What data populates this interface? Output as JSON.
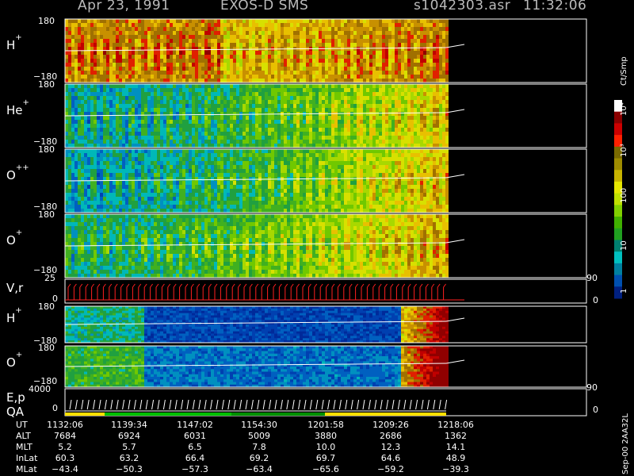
{
  "header": {
    "date": "Apr 23, 1991",
    "instrument": "EXOS-D SMS",
    "file": "s1042303.asr",
    "time": "11:32:06"
  },
  "panels": [
    {
      "ion": "H",
      "charge": "+",
      "y_top": "180",
      "y_bottom": "−180"
    },
    {
      "ion": "He",
      "charge": "+",
      "y_top": "180",
      "y_bottom": "−180"
    },
    {
      "ion": "O",
      "charge": "++",
      "y_top": "180",
      "y_bottom": "−180"
    },
    {
      "ion": "O",
      "charge": "+",
      "y_top": "180",
      "y_bottom": "−180"
    },
    {
      "ion": "V,r",
      "charge": "",
      "y_top": "25",
      "y_bottom": "0",
      "right_top": "90",
      "right_bottom": "0"
    },
    {
      "ion": "H",
      "charge": "+",
      "y_top": "180",
      "y_bottom": "−180"
    },
    {
      "ion": "O",
      "charge": "+",
      "y_top": "180",
      "y_bottom": "−180"
    },
    {
      "ion": "E,p",
      "charge": "",
      "y_top": "4000",
      "y_bottom": "0",
      "right_top": "90",
      "right_bottom": "0",
      "sub_label": "QA"
    }
  ],
  "colorbar": {
    "unit": "Ct/Smp",
    "tick_labels": [
      "10⁴",
      "10³",
      "100",
      "10",
      "1"
    ],
    "colors": [
      "#ffffff",
      "#8b0000",
      "#cc0000",
      "#ff2000",
      "#7a6a00",
      "#9e8c00",
      "#c8b400",
      "#e6e600",
      "#bfe000",
      "#80d000",
      "#40b000",
      "#20a020",
      "#008070",
      "#00c0c0",
      "#0080a0",
      "#0050b0",
      "#002080"
    ]
  },
  "footer": {
    "row_labels": [
      "UT",
      "ALT",
      "MLT",
      "InLat",
      "MLat"
    ],
    "columns": [
      [
        "1132:06",
        "7684",
        "5.2",
        "60.3",
        "−43.4"
      ],
      [
        "1139:34",
        "6924",
        "5.7",
        "63.2",
        "−50.3"
      ],
      [
        "1147:02",
        "6031",
        "6.5",
        "66.4",
        "−57.3"
      ],
      [
        "1154:30",
        "5009",
        "7.8",
        "69.2",
        "−63.4"
      ],
      [
        "1201:58",
        "3880",
        "10.0",
        "69.7",
        "−65.6"
      ],
      [
        "1209:26",
        "2686",
        "12.3",
        "64.6",
        "−59.2"
      ],
      [
        "1218:06",
        "1362",
        "14.1",
        "48.9",
        "−39.3"
      ]
    ],
    "side_note": "Sep-00 2AA32L"
  },
  "chart_data": {
    "type": "heatmap",
    "title": "Apr 23, 1991  EXOS-D SMS",
    "x_label": "UT",
    "x_ticks": [
      "1132:06",
      "1139:34",
      "1147:02",
      "1154:30",
      "1201:58",
      "1209:26",
      "1218:06"
    ],
    "panels": [
      "H+",
      "He+",
      "O++",
      "O+",
      "V,r",
      "H+",
      "O+",
      "E,p / QA"
    ],
    "y_range_pitch_angle": [
      -180,
      180
    ],
    "colorbar_unit": "Ct/Smp",
    "colorbar_scale": "log",
    "colorbar_range": [
      1,
      10000
    ]
  }
}
